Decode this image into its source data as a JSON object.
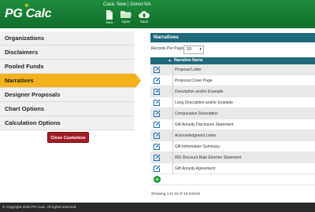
{
  "header": {
    "logo_text": "PG Calc",
    "case_info": "Case: New | Donor:NA",
    "tools": [
      {
        "label": "New",
        "icon": "new-document-icon"
      },
      {
        "label": "Open",
        "icon": "folder-icon"
      },
      {
        "label": "Save",
        "icon": "cloud-upload-icon"
      }
    ]
  },
  "sidebar": {
    "items": [
      {
        "label": "Organizations"
      },
      {
        "label": "Disclaimers"
      },
      {
        "label": "Pooled Funds"
      },
      {
        "label": "Narratives",
        "active": true
      },
      {
        "label": "Designer Proposals"
      },
      {
        "label": "Chart Options"
      },
      {
        "label": "Calculation Options"
      }
    ],
    "close_button": "Close Customize"
  },
  "main": {
    "title": "Narratives",
    "records_per_page_label": "Records Per Page",
    "records_per_page_value": "10",
    "column_header": "Narrative Name",
    "rows": [
      "Proposal Letter",
      "Proposal Cover Page",
      "Description and/or Example",
      "Long Description and/or Example",
      "Comparative Description",
      "Gift Annuity Disclosure Statement",
      "Acknowledgment Letter",
      "Gift Information Summary",
      "IRS Discount Rate Election Statement",
      "Gift Annuity Agreement"
    ],
    "showing_text": "Showing 1 to 10 of 10 entries"
  },
  "footer": {
    "copyright": "© Copyright 2020 PG Calc. All rights reserved."
  },
  "colors": {
    "header_green": "#1e8c3c",
    "active_orange": "#f3b21c",
    "panel_teal": "#1f6a7a",
    "close_button_red": "#a01c25"
  }
}
